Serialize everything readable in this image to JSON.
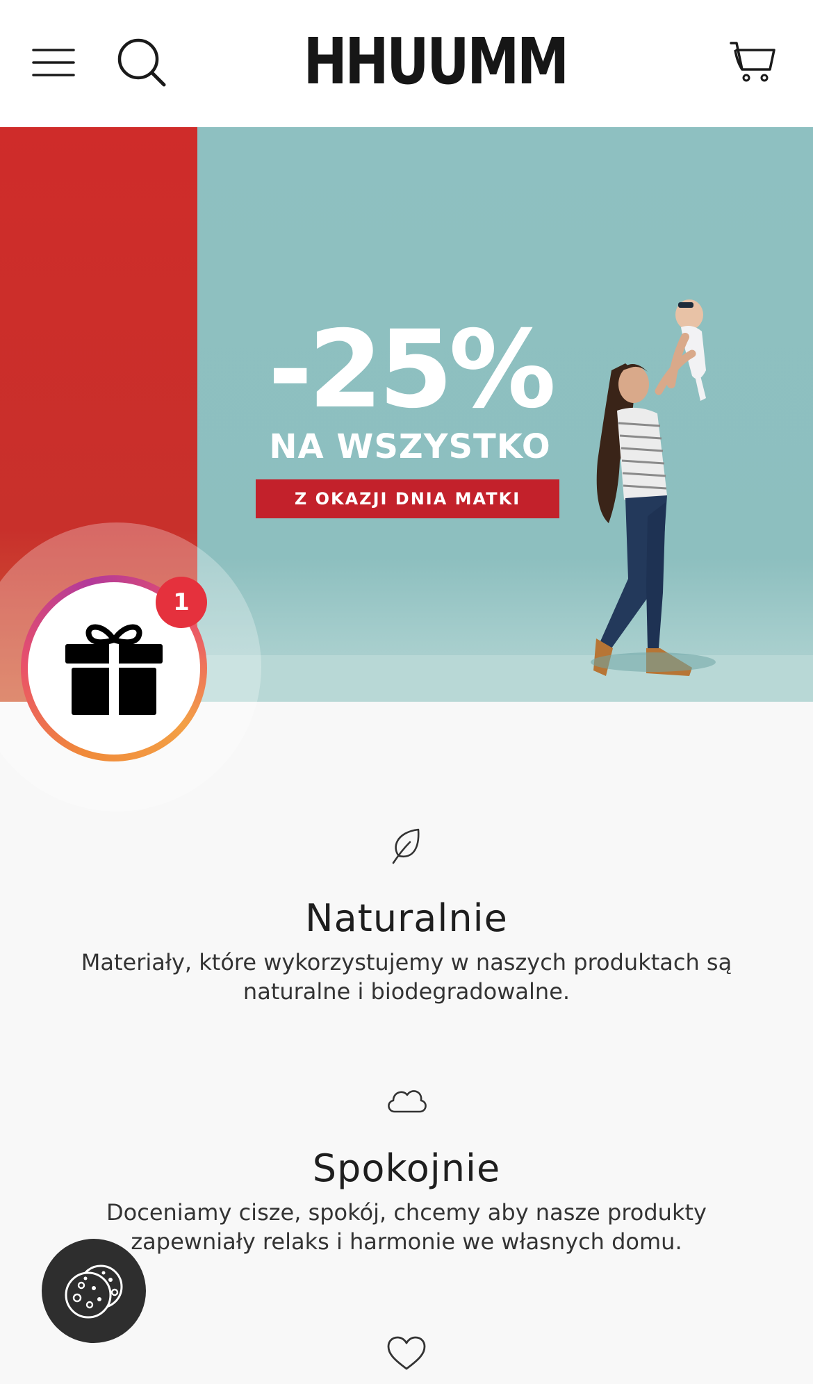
{
  "header": {
    "logo_text": "HHUUMM",
    "menu_icon": "hamburger-menu-icon",
    "search_icon": "search-icon",
    "cart_icon": "cart-icon"
  },
  "hero": {
    "discount": "-25%",
    "headline": "NA WSZYSTKO",
    "tag": "Z OKAZJI DNIA MATKI",
    "colors": {
      "red": "#cf2c2a",
      "teal": "#8ec0c1",
      "tag_bg": "#c3212b"
    }
  },
  "gift_widget": {
    "icon": "gift-icon",
    "badge_count": "1"
  },
  "features": [
    {
      "icon": "leaf-icon",
      "title": "Naturalnie",
      "text": "Materiały, które wykorzystujemy w naszych produktach są naturalne i biodegradowalne."
    },
    {
      "icon": "cloud-icon",
      "title": "Spokojnie",
      "text": "Doceniamy cisze, spokój, chcemy aby nasze produkty zapewniały relaks i harmonie we własnych domu."
    },
    {
      "icon": "heart-icon"
    }
  ],
  "cookie_button": {
    "icon": "cookie-icon"
  }
}
